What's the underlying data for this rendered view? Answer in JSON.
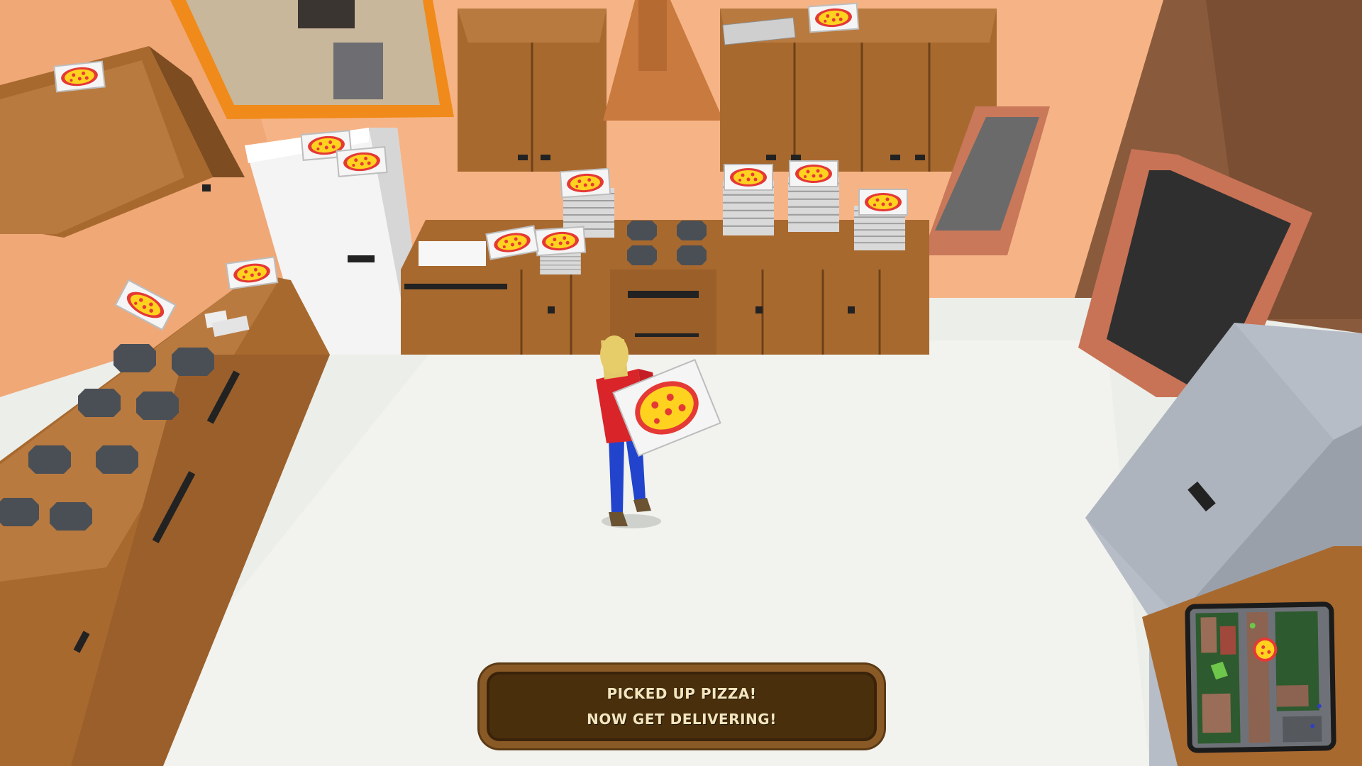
{
  "scene": {
    "description_icons": [
      "pizza-box-icon",
      "stove-icon",
      "fridge-icon",
      "door-icon"
    ]
  },
  "hud": {
    "notification": {
      "line1": "PiCKED UP PiZZA!",
      "line2": "NOW GET DELiVERiNG!"
    },
    "minimap": {
      "target_icon": "pizza-icon"
    }
  },
  "colors": {
    "floor": "#e9ebe6",
    "wall": "#f6b486",
    "cabinet": "#a86a35",
    "shirt": "#d9242a",
    "pants": "#2244cc",
    "hud_panel": "#4a2f0c",
    "hud_border": "#8a5a26",
    "hud_text": "#f3e6bf"
  }
}
